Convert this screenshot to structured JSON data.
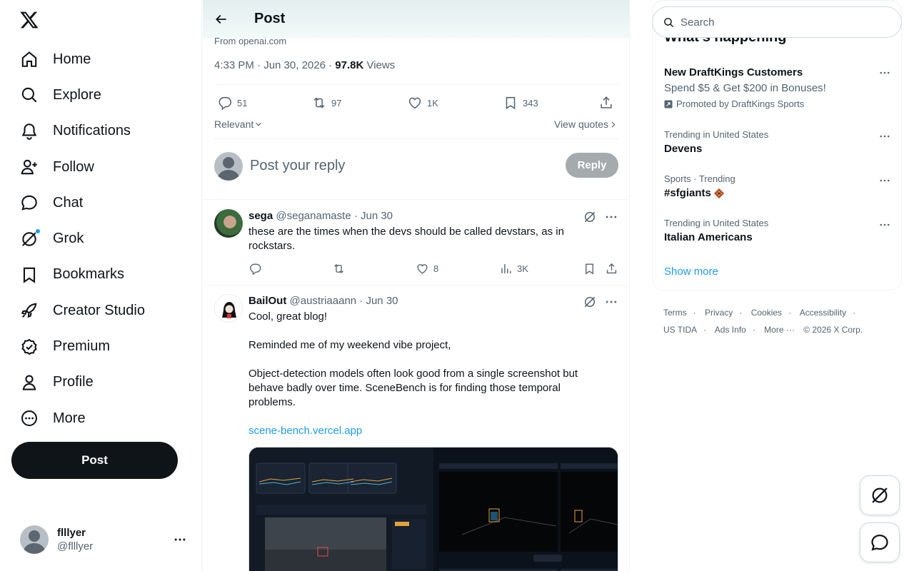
{
  "nav": {
    "items": [
      {
        "label": "Home",
        "icon": "home-icon"
      },
      {
        "label": "Explore",
        "icon": "search-icon"
      },
      {
        "label": "Notifications",
        "icon": "bell-icon"
      },
      {
        "label": "Follow",
        "icon": "person-add-icon"
      },
      {
        "label": "Chat",
        "icon": "chat-icon"
      },
      {
        "label": "Grok",
        "icon": "grok-icon"
      },
      {
        "label": "Bookmarks",
        "icon": "bookmark-icon"
      },
      {
        "label": "Creator Studio",
        "icon": "rocket-icon"
      },
      {
        "label": "Premium",
        "icon": "verified-icon"
      },
      {
        "label": "Profile",
        "icon": "person-icon"
      },
      {
        "label": "More",
        "icon": "more-circle-icon"
      }
    ],
    "post_label": "Post"
  },
  "account": {
    "display_name": "flllyer",
    "handle": "@flllyer"
  },
  "header": {
    "title": "Post"
  },
  "post": {
    "source": "From openai.com",
    "time": "4:33 PM · Jun 30, 2026",
    "views_count": "97.8K",
    "views_label": "Views",
    "replies": "51",
    "reposts": "97",
    "likes": "1K",
    "bookmarks": "343"
  },
  "sort": {
    "label": "Relevant",
    "quotes_label": "View quotes"
  },
  "composer": {
    "placeholder": "Post your reply",
    "button_label": "Reply"
  },
  "replies": [
    {
      "name": "sega",
      "handle": "@seganamaste · Jun 30",
      "text": "these are the times when the devs should be called devstars, as in rockstars.",
      "likes": "8",
      "views": "3K"
    },
    {
      "name": "BailOut",
      "handle": "@austriaaann · Jun 30",
      "text": "Cool, great blog!\n\nReminded me of my weekend vibe project,\n\nObject-detection models often look good from a single screenshot but behave badly over time. SceneBench is for finding those temporal problems.",
      "link": "scene-bench.vercel.app"
    }
  ],
  "search": {
    "placeholder": "Search"
  },
  "trends": {
    "heading": "What’s happening",
    "promo": {
      "title": "New DraftKings Customers",
      "subtitle": "Spend $5 & Get $200 in Bonuses!",
      "promoted": "Promoted by DraftKings Sports"
    },
    "items": [
      {
        "context": "Trending in United States",
        "name": "Devens"
      },
      {
        "context": "Sports · Trending",
        "name": "#sfgiants"
      },
      {
        "context": "Trending in United States",
        "name": "Italian Americans"
      }
    ],
    "show_more": "Show more"
  },
  "footer": {
    "links": [
      "Terms",
      "Privacy",
      "Cookies",
      "Accessibility",
      "US TIDA",
      "Ads Info",
      "More ···"
    ],
    "copyright": "© 2026 X Corp."
  },
  "colors": {
    "accent": "#1d9bf0",
    "text": "#0f1419",
    "muted": "#536471",
    "border": "#eff3f4"
  }
}
